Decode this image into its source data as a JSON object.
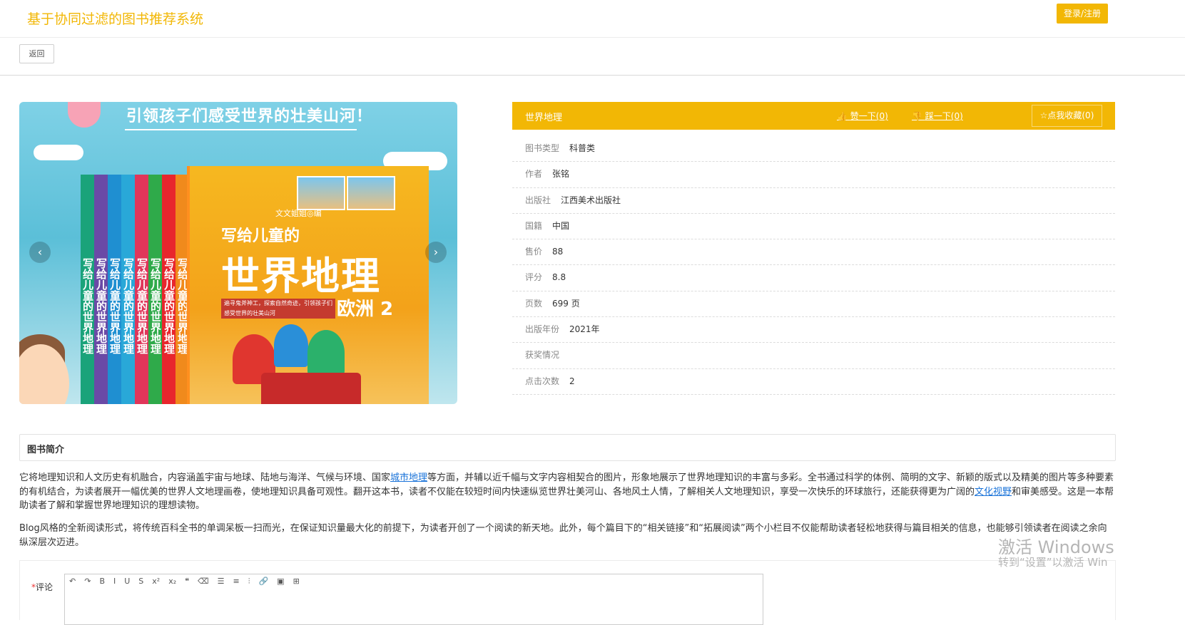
{
  "header": {
    "site_title": "基于协同过滤的图书推荐系统",
    "login_label": "登录/注册"
  },
  "nav": {
    "back_label": "返回"
  },
  "cover": {
    "slogan": "引领孩子们感受世界的壮美山河！",
    "spine_text": "写给儿童的世界地理",
    "front_sub": "写给儿童的",
    "front_main": "世界地理",
    "front_volume": "欧洲 2",
    "front_publisher": "文文姐姐◎编",
    "front_tagline": "遍寻鬼斧神工，探索自然奇迹，引领孩子们感受世界的壮美山河",
    "prev_icon": "‹",
    "next_icon": "›"
  },
  "book": {
    "title": "世界地理",
    "like_label": "赞一下(0)",
    "dislike_label": "踩一下(0)",
    "favorite_label": "点我收藏(0)",
    "fields": [
      {
        "label": "图书类型",
        "value": "科普类"
      },
      {
        "label": "作者",
        "value": "张铭"
      },
      {
        "label": "出版社",
        "value": "江西美术出版社"
      },
      {
        "label": "国籍",
        "value": "中国"
      },
      {
        "label": "售价",
        "value": "88"
      },
      {
        "label": "评分",
        "value": "8.8"
      },
      {
        "label": "页数",
        "value": "699 页"
      },
      {
        "label": "出版年份",
        "value": "2021年"
      },
      {
        "label": "获奖情况",
        "value": ""
      },
      {
        "label": "点击次数",
        "value": "2"
      }
    ]
  },
  "intro": {
    "heading": "图书简介",
    "p1_a": "它将地理知识和人文历史有机融合，内容涵盖宇宙与地球、陆地与海洋、气候与环境、国家",
    "p1_link1": "城市地理",
    "p1_b": "等方面，并辅以近千幅与文字内容相契合的图片，形象地展示了世界地理知识的丰富与多彩。全书通过科学的体例、简明的文字、新颖的版式以及精美的图片等多种要素的有机结合，为读者展开一幅优美的世界人文地理画卷，使地理知识具备可观性。翻开这本书，读者不仅能在较短时间内快速纵览世界壮美河山、各地风土人情，了解相关人文地理知识，享受一次快乐的环球旅行，还能获得更为广阔的",
    "p1_link2": "文化视野",
    "p1_c": "和审美感受。这是一本帮助读者了解和掌握世界地理知识的理想读物。",
    "p2": "Blog风格的全新阅读形式，将传统百科全书的单调呆板一扫而光，在保证知识量最大化的前提下，为读者开创了一个阅读的新天地。此外，每个篇目下的“相关链接”和“拓展阅读”两个小栏目不仅能帮助读者轻松地获得与篇目相关的信息，也能够引领读者在阅读之余向纵深层次迈进。"
  },
  "comment": {
    "required_mark": "*",
    "label": "评论"
  },
  "watermark": {
    "line1": "激活 Windows",
    "line2": "转到“设置”以激活 Win"
  },
  "colors": {
    "accent": "#f2b705",
    "link": "#1a73d9"
  }
}
